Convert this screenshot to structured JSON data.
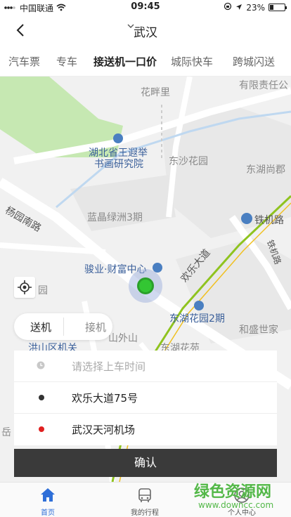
{
  "status_bar": {
    "carrier": "中国联通",
    "time": "09:45",
    "battery": "23%",
    "battery_level": 0.23
  },
  "nav": {
    "title": "武汉"
  },
  "tabs": [
    {
      "label": "汽车票"
    },
    {
      "label": "专车"
    },
    {
      "label": "接送机一口价"
    },
    {
      "label": "城际快车"
    },
    {
      "label": "跨城闪送"
    }
  ],
  "map": {
    "labels": [
      "花畔里",
      "有限责任公",
      "湖北省王遐举",
      "书画研究院",
      "东沙花园",
      "东湖尚郡",
      "杨园南路",
      "蓝晶绿洲3期",
      "铁机路",
      "铁机路",
      "欢乐大道",
      "骏业·财富中心",
      "园",
      "东湖花园2期",
      "山外山",
      "和盛世家",
      "洪山区机关",
      "东湖花苑",
      "岳"
    ]
  },
  "mode_toggle": {
    "send": "送机",
    "pickup": "接机"
  },
  "form": {
    "time_placeholder": "请选择上车时间",
    "origin": "欢乐大道75号",
    "destination": "武汉天河机场"
  },
  "confirm_label": "确认",
  "bottom_nav": [
    {
      "label": "首页",
      "icon": "home-icon"
    },
    {
      "label": "我的行程",
      "icon": "bus-icon"
    },
    {
      "label": "个人中心",
      "icon": "user-icon"
    }
  ],
  "watermark": {
    "title": "绿色资源网",
    "url": "www.downcc.com"
  },
  "colors": {
    "accent_blue": "#2f6fd8",
    "pin_green": "#33c633",
    "destination_red": "#e02020",
    "confirm_bg": "#3a3a3a",
    "watermark_green": "#53b848"
  }
}
